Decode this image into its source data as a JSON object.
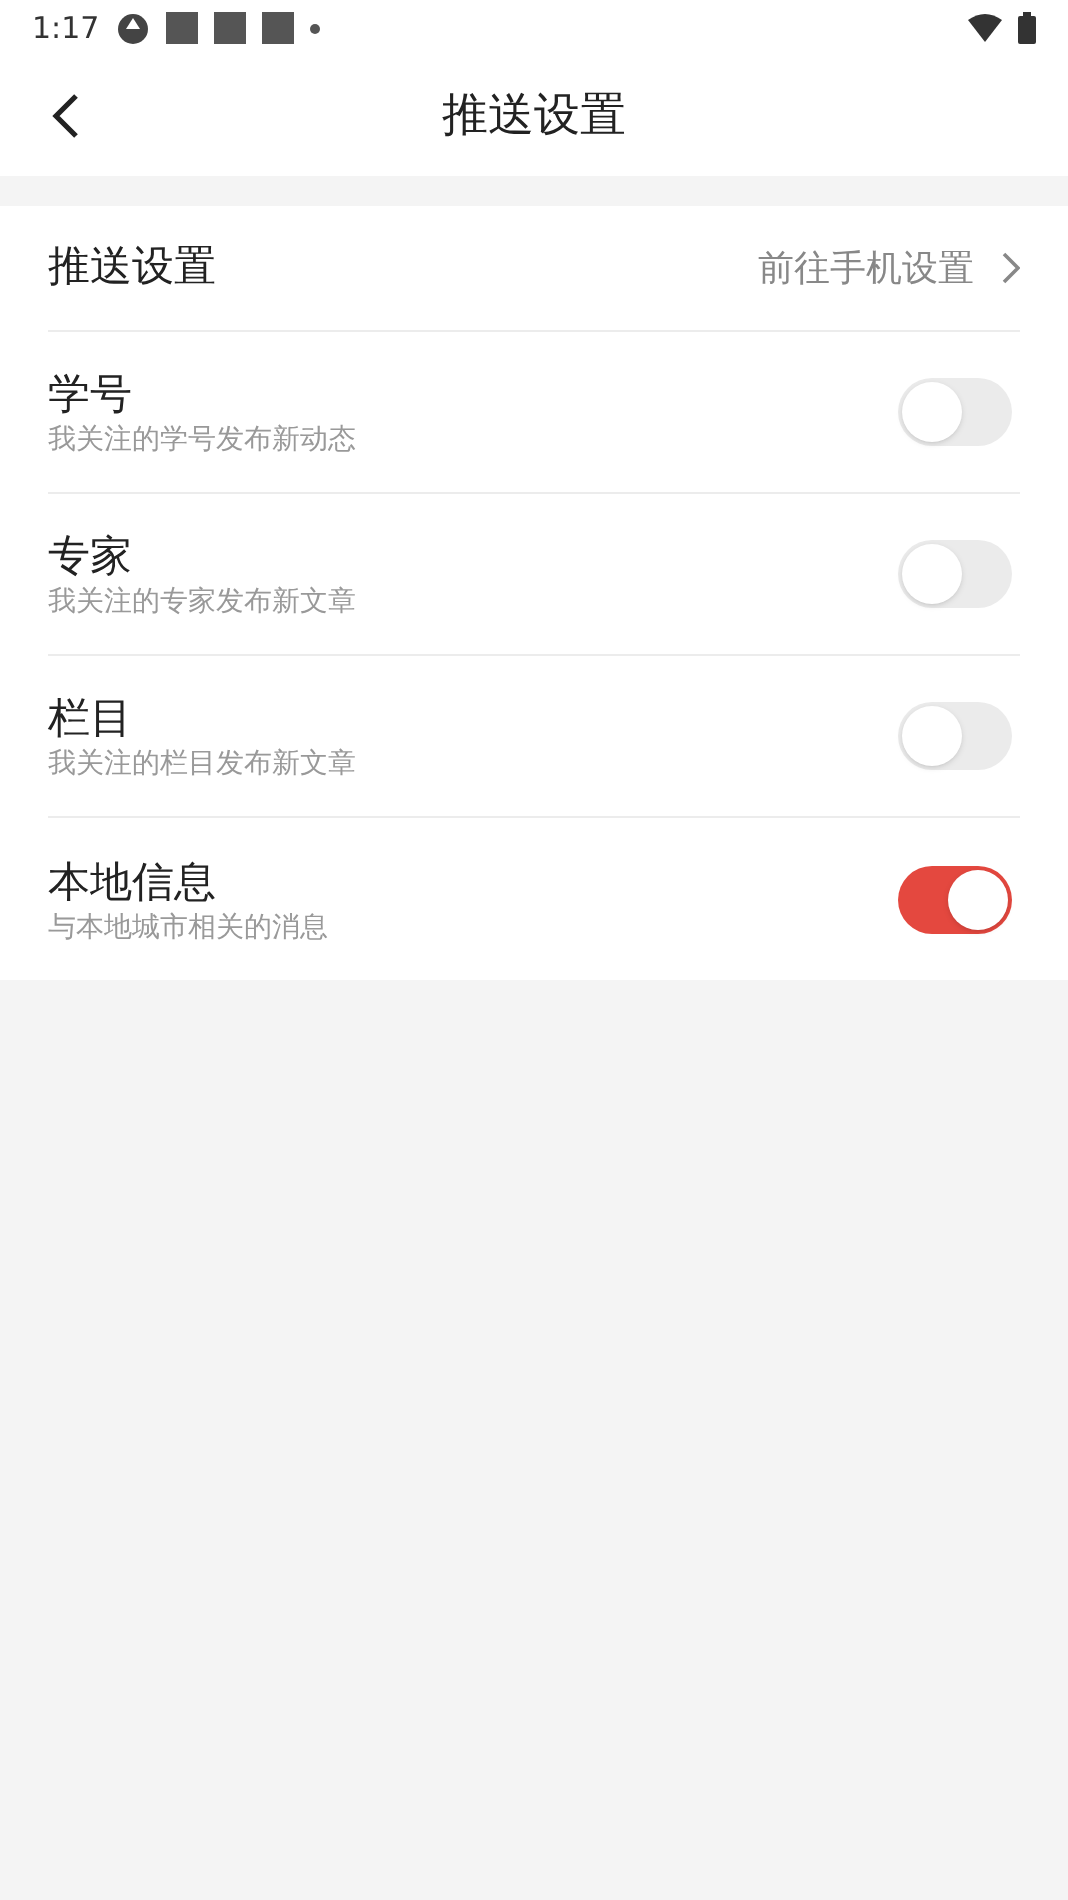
{
  "status_bar": {
    "time": "1:17"
  },
  "header": {
    "title": "推送设置"
  },
  "link_row": {
    "label": "推送设置",
    "value": "前往手机设置"
  },
  "settings": [
    {
      "title": "学号",
      "subtitle": "我关注的学号发布新动态",
      "on": false
    },
    {
      "title": "专家",
      "subtitle": "我关注的专家发布新文章",
      "on": false
    },
    {
      "title": "栏目",
      "subtitle": "我关注的栏目发布新文章",
      "on": false
    },
    {
      "title": "本地信息",
      "subtitle": "与本地城市相关的消息",
      "on": true
    }
  ]
}
